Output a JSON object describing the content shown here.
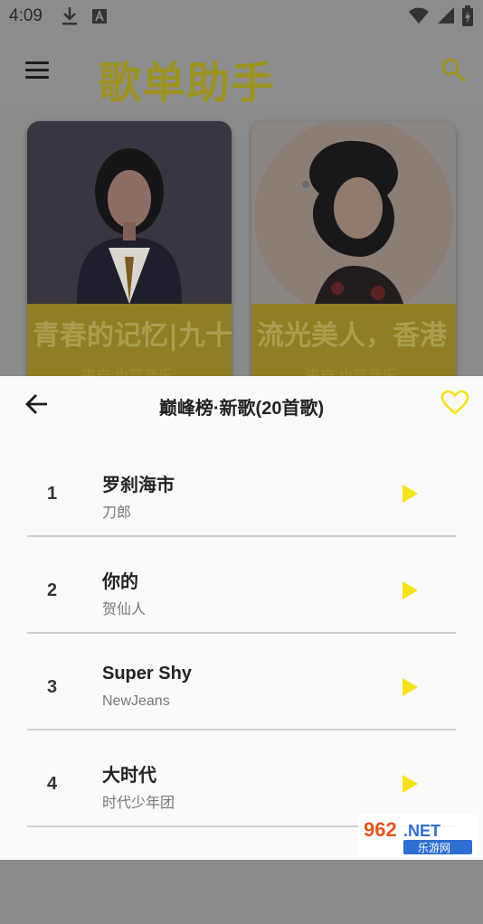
{
  "status_bar": {
    "time": "4:09"
  },
  "app_bar": {
    "title": "歌单助手"
  },
  "cards": [
    {
      "title": "青春的记忆|九十",
      "subtitle": "来自 小芸音乐"
    },
    {
      "title": "流光美人，香港",
      "subtitle": "来自 小芸音乐"
    }
  ],
  "sheet": {
    "title": "巅峰榜·新歌(20首歌)",
    "songs": [
      {
        "rank": "1",
        "name": "罗刹海市",
        "artist": "刀郎"
      },
      {
        "rank": "2",
        "name": "你的",
        "artist": "贺仙人"
      },
      {
        "rank": "3",
        "name": "Super Shy",
        "artist": "NewJeans"
      },
      {
        "rank": "4",
        "name": "大时代",
        "artist": "时代少年团"
      },
      {
        "rank": "",
        "name": "",
        "artist": ""
      }
    ]
  },
  "watermark": {
    "top": "962.NET",
    "bottom": "乐游网"
  },
  "colors": {
    "accent": "#f5e11a",
    "scrim": "#8a8a8a",
    "sheet_bg": "#fafafa"
  }
}
